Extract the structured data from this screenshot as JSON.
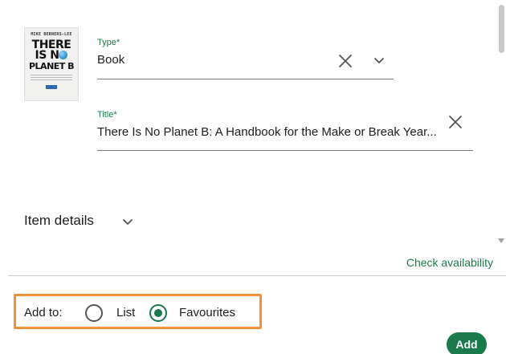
{
  "cover": {
    "author": "MIKE BERNERS-LEE",
    "line1": "THERE",
    "line2": "IS N",
    "line3": "PLANET B"
  },
  "type_field": {
    "label": "Type*",
    "value": "Book"
  },
  "title_field": {
    "label": "Title*",
    "value": "There Is No Planet B: A Handbook for the Make or Break Year..."
  },
  "item_details": {
    "label": "Item details"
  },
  "availability": {
    "link_label": "Check availability"
  },
  "add_to": {
    "label": "Add to:",
    "options": [
      {
        "label": "List",
        "selected": false
      },
      {
        "label": "Favourites",
        "selected": true
      }
    ]
  },
  "actions": {
    "add_label": "Add"
  },
  "colors": {
    "accent": "#1a7a4c",
    "highlight_border": "#f0913a"
  },
  "icons": {
    "clear": "close-icon",
    "expand": "chevron-down-icon"
  }
}
